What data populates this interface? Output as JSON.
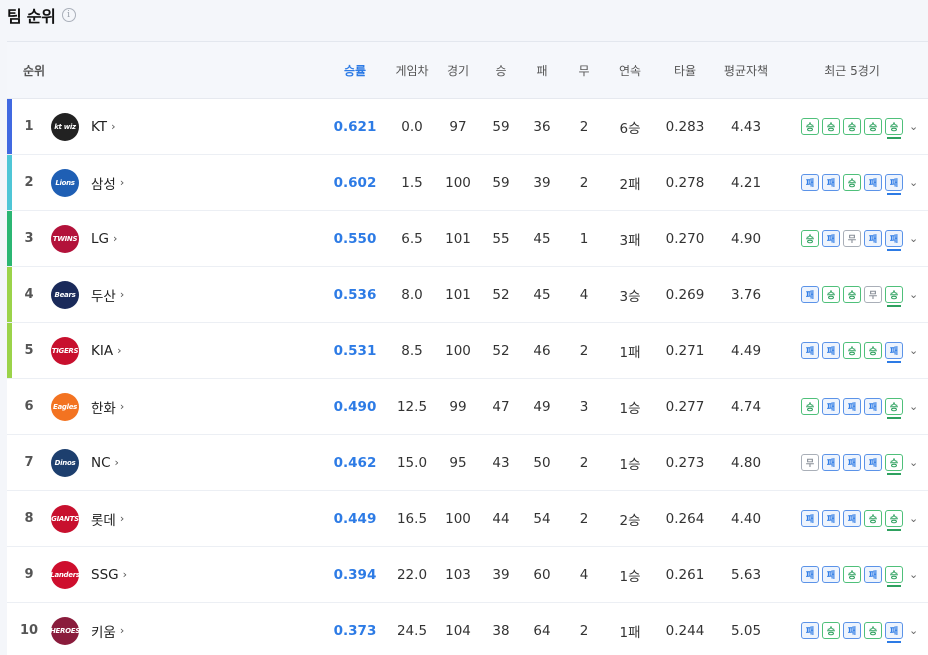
{
  "title": "팀 순위",
  "info_icon": "info-icon",
  "headers": {
    "rank": "순위",
    "pct": "승률",
    "gb": "게임차",
    "games": "경기",
    "wins": "승",
    "losses": "패",
    "draws": "무",
    "streak": "연속",
    "avg": "타율",
    "era": "평균자책",
    "recent": "최근 5경기"
  },
  "colors": {
    "accent": "#2d7be5",
    "win": "#2ea15f",
    "loss": "#2d7be5",
    "draw": "#8a9099"
  },
  "teams": [
    {
      "rank": "1",
      "name": "KT",
      "logo": "kt-wiz-logo",
      "logo_text": "kt wiz",
      "logo_color": "#222222",
      "bar": "#4169e1",
      "pct": "0.621",
      "gb": "0.0",
      "games": "97",
      "wins": "59",
      "losses": "36",
      "draws": "2",
      "streak": "6승",
      "avg": "0.283",
      "era": "4.43",
      "recent": [
        "승",
        "승",
        "승",
        "승",
        "승"
      ]
    },
    {
      "rank": "2",
      "name": "삼성",
      "logo": "samsung-lions-logo",
      "logo_text": "Lions",
      "logo_color": "#1f5fb4",
      "bar": "#4fc6d6",
      "pct": "0.602",
      "gb": "1.5",
      "games": "100",
      "wins": "59",
      "losses": "39",
      "draws": "2",
      "streak": "2패",
      "avg": "0.278",
      "era": "4.21",
      "recent": [
        "패",
        "패",
        "승",
        "패",
        "패"
      ]
    },
    {
      "rank": "3",
      "name": "LG",
      "logo": "lg-twins-logo",
      "logo_text": "TWINS",
      "logo_color": "#b3123a",
      "bar": "#2bb673",
      "pct": "0.550",
      "gb": "6.5",
      "games": "101",
      "wins": "55",
      "losses": "45",
      "draws": "1",
      "streak": "3패",
      "avg": "0.270",
      "era": "4.90",
      "recent": [
        "승",
        "패",
        "무",
        "패",
        "패"
      ]
    },
    {
      "rank": "4",
      "name": "두산",
      "logo": "doosan-bears-logo",
      "logo_text": "Bears",
      "logo_color": "#1a2a5a",
      "bar": "#9bd34a",
      "pct": "0.536",
      "gb": "8.0",
      "games": "101",
      "wins": "52",
      "losses": "45",
      "draws": "4",
      "streak": "3승",
      "avg": "0.269",
      "era": "3.76",
      "recent": [
        "패",
        "승",
        "승",
        "무",
        "승"
      ]
    },
    {
      "rank": "5",
      "name": "KIA",
      "logo": "kia-tigers-logo",
      "logo_text": "TIGERS",
      "logo_color": "#c8102e",
      "bar": "#9bd34a",
      "pct": "0.531",
      "gb": "8.5",
      "games": "100",
      "wins": "52",
      "losses": "46",
      "draws": "2",
      "streak": "1패",
      "avg": "0.271",
      "era": "4.49",
      "recent": [
        "패",
        "패",
        "승",
        "승",
        "패"
      ]
    },
    {
      "rank": "6",
      "name": "한화",
      "logo": "hanwha-eagles-logo",
      "logo_text": "Eagles",
      "logo_color": "#f37321",
      "bar": "",
      "pct": "0.490",
      "gb": "12.5",
      "games": "99",
      "wins": "47",
      "losses": "49",
      "draws": "3",
      "streak": "1승",
      "avg": "0.277",
      "era": "4.74",
      "recent": [
        "승",
        "패",
        "패",
        "패",
        "승"
      ]
    },
    {
      "rank": "7",
      "name": "NC",
      "logo": "nc-dinos-logo",
      "logo_text": "Dinos",
      "logo_color": "#1d3f6e",
      "bar": "",
      "pct": "0.462",
      "gb": "15.0",
      "games": "95",
      "wins": "43",
      "losses": "50",
      "draws": "2",
      "streak": "1승",
      "avg": "0.273",
      "era": "4.80",
      "recent": [
        "무",
        "패",
        "패",
        "패",
        "승"
      ]
    },
    {
      "rank": "8",
      "name": "롯데",
      "logo": "lotte-giants-logo",
      "logo_text": "GIANTS",
      "logo_color": "#c8102e",
      "bar": "",
      "pct": "0.449",
      "gb": "16.5",
      "games": "100",
      "wins": "44",
      "losses": "54",
      "draws": "2",
      "streak": "2승",
      "avg": "0.264",
      "era": "4.40",
      "recent": [
        "패",
        "패",
        "패",
        "승",
        "승"
      ]
    },
    {
      "rank": "9",
      "name": "SSG",
      "logo": "ssg-landers-logo",
      "logo_text": "Landers",
      "logo_color": "#ce0e2d",
      "bar": "",
      "pct": "0.394",
      "gb": "22.0",
      "games": "103",
      "wins": "39",
      "losses": "60",
      "draws": "4",
      "streak": "1승",
      "avg": "0.261",
      "era": "5.63",
      "recent": [
        "패",
        "패",
        "승",
        "패",
        "승"
      ]
    },
    {
      "rank": "10",
      "name": "키움",
      "logo": "kiwoom-heroes-logo",
      "logo_text": "HEROES",
      "logo_color": "#8a1c3c",
      "bar": "",
      "pct": "0.373",
      "gb": "24.5",
      "games": "104",
      "wins": "38",
      "losses": "64",
      "draws": "2",
      "streak": "1패",
      "avg": "0.244",
      "era": "5.05",
      "recent": [
        "패",
        "승",
        "패",
        "승",
        "패"
      ]
    }
  ]
}
